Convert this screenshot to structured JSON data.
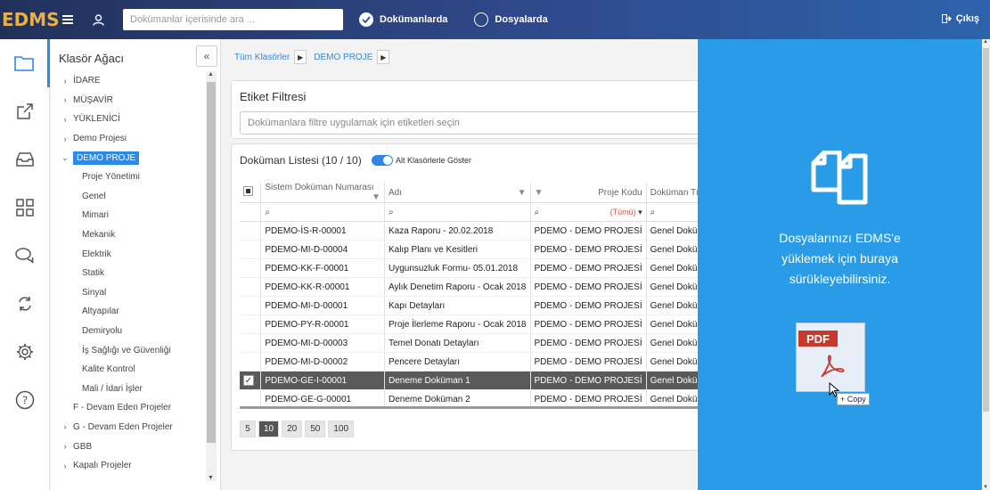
{
  "app": {
    "logo": "EDMS"
  },
  "topbar": {
    "search_placeholder": "Dokümanlar içerisinde ara ...",
    "scope_documents": "Dokümanlarda",
    "scope_files": "Dosyalarda",
    "logout": "Çıkış"
  },
  "leftnav": {
    "items": [
      "folder-icon",
      "share-icon",
      "inbox-icon",
      "grid-icon",
      "chat-icon",
      "sync-icon",
      "gear-icon",
      "help-icon"
    ]
  },
  "tree": {
    "title": "Klasör Ağacı",
    "collapse": "«",
    "items": [
      {
        "label": "İDARE",
        "level": 0,
        "caret": "›"
      },
      {
        "label": "MÜŞAVİR",
        "level": 0,
        "caret": "›"
      },
      {
        "label": "YÜKLENİCİ",
        "level": 0,
        "caret": "›"
      },
      {
        "label": "Demo Projesi",
        "level": 0,
        "caret": "›"
      },
      {
        "label": "DEMO PROJE",
        "level": 0,
        "caret": "⌄",
        "selected": true
      },
      {
        "label": "Proje Yönetimi",
        "level": 2,
        "caret": ""
      },
      {
        "label": "Genel",
        "level": 2,
        "caret": ""
      },
      {
        "label": "Mimari",
        "level": 2,
        "caret": ""
      },
      {
        "label": "Mekanik",
        "level": 2,
        "caret": ""
      },
      {
        "label": "Elektrik",
        "level": 2,
        "caret": ""
      },
      {
        "label": "Statik",
        "level": 2,
        "caret": ""
      },
      {
        "label": "Sinyal",
        "level": 2,
        "caret": ""
      },
      {
        "label": "Altyapılar",
        "level": 2,
        "caret": ""
      },
      {
        "label": "Demiryolu",
        "level": 2,
        "caret": ""
      },
      {
        "label": "İş Sağlığı ve Güvenliği",
        "level": 2,
        "caret": ""
      },
      {
        "label": "Kalite Kontrol",
        "level": 2,
        "caret": ""
      },
      {
        "label": "Mali / İdari İşler",
        "level": 2,
        "caret": ""
      },
      {
        "label": "F - Devam Eden Projeler",
        "level": 1,
        "caret": ""
      },
      {
        "label": "G - Devam Eden Projeler",
        "level": 0,
        "caret": "›"
      },
      {
        "label": "GBB",
        "level": 0,
        "caret": "›"
      },
      {
        "label": "Kapalı Projeler",
        "level": 0,
        "caret": "›"
      }
    ]
  },
  "breadcrumb": [
    "Tüm Klasörler",
    "DEMO PROJE"
  ],
  "tag_filter": {
    "title": "Etiket Filtresi",
    "placeholder": "Dokümanlara filtre uygulamak için etiketleri seçin"
  },
  "doc_list": {
    "title": "Doküman Listesi (10 / 10)",
    "toggle_label": "Alt Klasörlerle Göster",
    "columns": [
      "Sistem Doküman Numarası",
      "Adı",
      "Proje Kodu",
      "Doküman Türü"
    ],
    "filter_all": "(Tümü)",
    "rows": [
      {
        "no": "PDEMO-İS-R-00001",
        "name": "Kaza Raporu - 20.02.2018",
        "project": "PDEMO - DEMO PROJESİ",
        "type": "Genel Doküman",
        "selected": false
      },
      {
        "no": "PDEMO-MI-D-00004",
        "name": "Kalıp Planı ve Kesitleri",
        "project": "PDEMO - DEMO PROJESİ",
        "type": "Genel Doküman",
        "selected": false
      },
      {
        "no": "PDEMO-KK-F-00001",
        "name": "Uygunsuzluk Formu- 05.01.2018",
        "project": "PDEMO - DEMO PROJESİ",
        "type": "Genel Doküman",
        "selected": false
      },
      {
        "no": "PDEMO-KK-R-00001",
        "name": "Aylık Denetim Raporu - Ocak 2018",
        "project": "PDEMO - DEMO PROJESİ",
        "type": "Genel Doküman",
        "selected": false
      },
      {
        "no": "PDEMO-MI-D-00001",
        "name": "Kapı Detayları",
        "project": "PDEMO - DEMO PROJESİ",
        "type": "Genel Doküman",
        "selected": false
      },
      {
        "no": "PDEMO-PY-R-00001",
        "name": "Proje İlerleme Raporu - Ocak 2018",
        "project": "PDEMO - DEMO PROJESİ",
        "type": "Genel Doküman",
        "selected": false
      },
      {
        "no": "PDEMO-MI-D-00003",
        "name": "Temel Donatı Detayları",
        "project": "PDEMO - DEMO PROJESİ",
        "type": "Genel Doküman",
        "selected": false
      },
      {
        "no": "PDEMO-MI-D-00002",
        "name": "Pencere Detayları",
        "project": "PDEMO - DEMO PROJESİ",
        "type": "Genel Doküman",
        "selected": false
      },
      {
        "no": "PDEMO-GE-I-00001",
        "name": "Deneme Doküman 1",
        "project": "PDEMO - DEMO PROJESİ",
        "type": "Genel Doküman",
        "selected": true
      },
      {
        "no": "PDEMO-GE-G-00001",
        "name": "Deneme Doküman 2",
        "project": "PDEMO - DEMO PROJESİ",
        "type": "Genel Doküman",
        "selected": false
      }
    ],
    "page_sizes": [
      "5",
      "10",
      "20",
      "50",
      "100"
    ],
    "active_page_size": "10"
  },
  "dropzone": {
    "line1": "Dosyalarınızı EDMS'e",
    "line2": "yüklemek için buraya",
    "line3": "sürükleyebilirsiniz.",
    "pdf_label": "PDF",
    "copy_label": "+ Copy"
  },
  "colors": {
    "accent": "#2d89e5",
    "dropzone": "#2a9be7",
    "logo": "#e8b04a"
  }
}
